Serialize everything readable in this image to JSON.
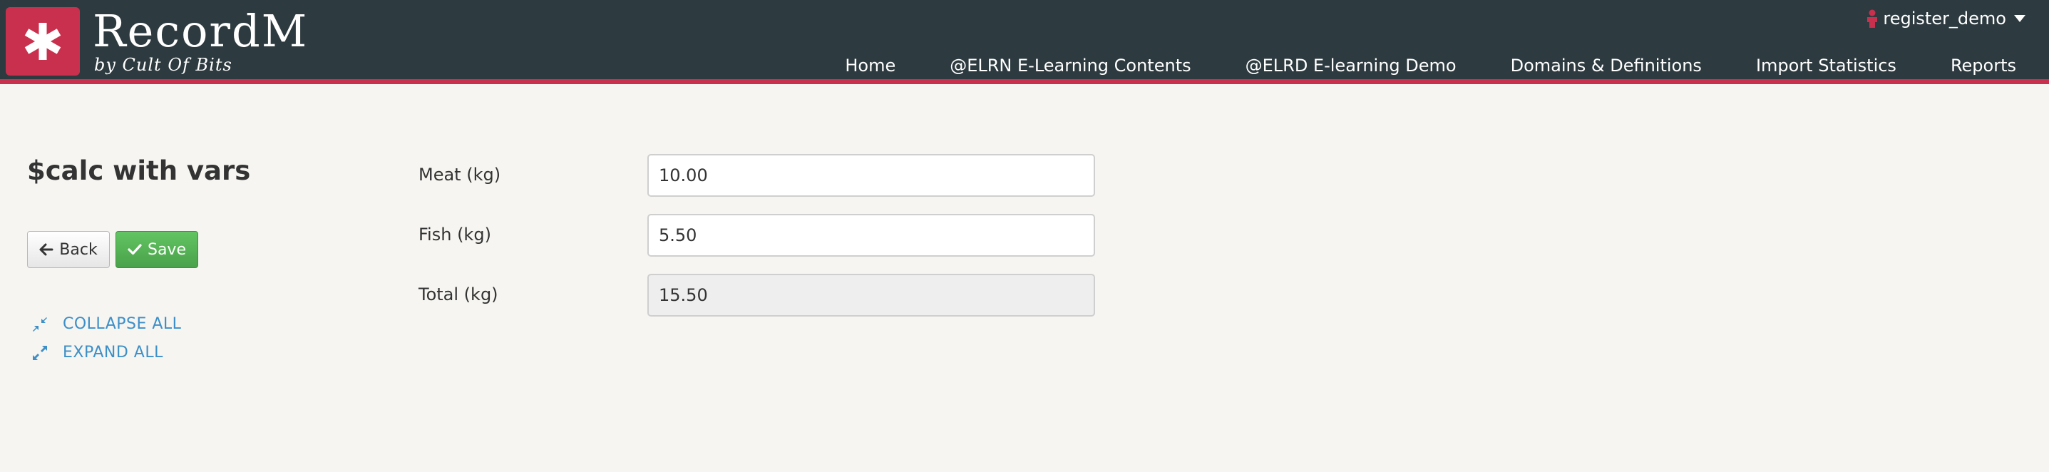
{
  "header": {
    "brand": "RecordM",
    "brand_sub": "by Cult Of Bits",
    "user": "register_demo",
    "nav": [
      "Home",
      "@ELRN E-Learning Contents",
      "@ELRD E-learning Demo",
      "Domains & Definitions",
      "Import Statistics",
      "Reports"
    ],
    "accent_color": "#c9304d",
    "bar_color": "#2d3a3f"
  },
  "sidebar": {
    "title": "$calc with vars",
    "back_label": "Back",
    "save_label": "Save",
    "collapse_all": "COLLAPSE ALL",
    "expand_all": "EXPAND ALL"
  },
  "form": {
    "fields": [
      {
        "label": "Meat (kg)",
        "value": "10.00"
      },
      {
        "label": "Fish (kg)",
        "value": "5.50"
      },
      {
        "label": "Total (kg)",
        "value": "15.50"
      }
    ]
  },
  "icons": {
    "logo": "asterisk-icon",
    "user": "user-icon",
    "caret": "caret-down-icon",
    "back": "arrow-left-icon",
    "save": "check-icon",
    "collapse": "compress-icon",
    "expand": "expand-icon"
  }
}
